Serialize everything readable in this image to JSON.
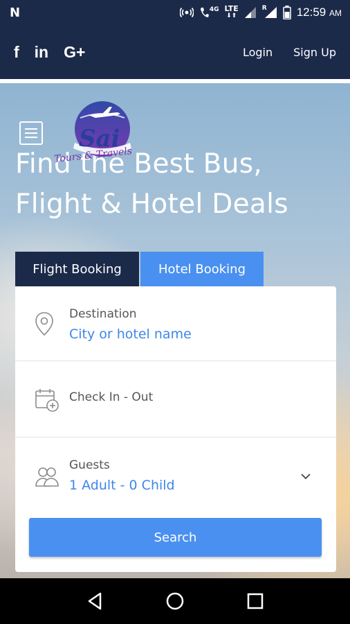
{
  "status_bar": {
    "carrier_glyph": "N",
    "network_4g": "4G",
    "network_lte": "LTE",
    "roaming": "R",
    "time": "12:59",
    "ampm": "AM"
  },
  "topnav": {
    "social": {
      "facebook": "f",
      "linkedin": "in",
      "google_plus": "G+"
    },
    "login_label": "Login",
    "signup_label": "Sign Up"
  },
  "logo": {
    "brand": "Sai",
    "tagline": "Tours & Travels"
  },
  "hero": {
    "title_line1": "Find the Best Bus,",
    "title_line2": "Flight & Hotel Deals"
  },
  "tabs": {
    "flight": "Flight Booking",
    "hotel": "Hotel Booking",
    "active": "hotel"
  },
  "form": {
    "destination": {
      "label": "Destination",
      "placeholder": "City or hotel name"
    },
    "checkin": {
      "label": "Check In - Out"
    },
    "guests": {
      "label": "Guests",
      "value": "1 Adult - 0 Child"
    },
    "search_label": "Search"
  },
  "colors": {
    "navy": "#1c2a4a",
    "accent_blue": "#4a90f0",
    "link_blue": "#3d86ea"
  }
}
